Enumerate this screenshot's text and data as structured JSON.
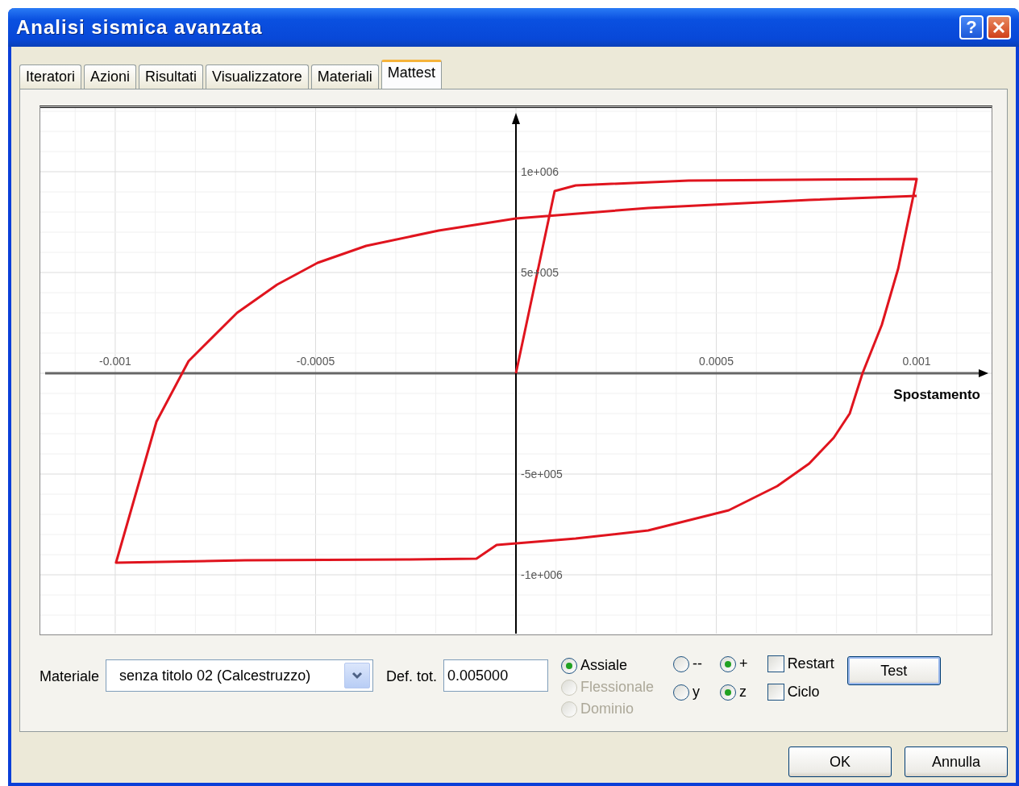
{
  "window": {
    "title": "Analisi sismica avanzata",
    "help_button": "?"
  },
  "tabs": [
    {
      "label": "Iteratori",
      "selected": false
    },
    {
      "label": "Azioni",
      "selected": false
    },
    {
      "label": "Risultati",
      "selected": false
    },
    {
      "label": "Visualizzatore",
      "selected": false
    },
    {
      "label": "Materiali",
      "selected": false
    },
    {
      "label": "Mattest",
      "selected": true
    }
  ],
  "chart": {
    "chart_data": {
      "type": "line",
      "grid": true,
      "xlabel": "Spostamento",
      "xlim": [
        -0.001187,
        0.001187
      ],
      "ylim": [
        -1292000,
        1316000
      ],
      "xticks": [
        {
          "value": -0.001,
          "label": "-0.001"
        },
        {
          "value": -0.0005,
          "label": "-0.0005"
        },
        {
          "value": 0.0005,
          "label": "0.0005"
        },
        {
          "value": 0.001,
          "label": "0.001"
        }
      ],
      "yticks": [
        {
          "value": 1000000,
          "label": "1e+006"
        },
        {
          "value": 500000,
          "label": "5e+005"
        },
        {
          "value": -500000,
          "label": "-5e+005"
        },
        {
          "value": -1000000,
          "label": "-1e+006"
        }
      ],
      "x": [
        0,
        9.66e-05,
        0.000149,
        0.000431,
        0.001,
        0.00099,
        0.000954,
        0.000913,
        0.000865,
        0.000833,
        0.000793,
        0.000732,
        0.000652,
        0.000531,
        0.00033,
        0.000149,
        -4.83e-05,
        -9.86e-05,
        -0.000274,
        -0.000676,
        -0.000998,
        -0.000897,
        -0.000817,
        -0.000696,
        -0.000596,
        -0.000495,
        -0.000374,
        -0.000193,
        0,
        0.00033,
        0.000732,
        0.001
      ],
      "series": [
        {
          "color": "#e0141e",
          "values": [
            0,
            904000,
            932000,
            956000,
            964000,
            864000,
            520000,
            240000,
            0,
            -200000,
            -320000,
            -448000,
            -560000,
            -680000,
            -780000,
            -820000,
            -852000,
            -920000,
            -924000,
            -928000,
            -940000,
            -240000,
            60000,
            300000,
            440000,
            548000,
            632000,
            708000,
            768000,
            820000,
            860000,
            880000
          ]
        }
      ]
    }
  },
  "controls": {
    "material_label": "Materiale",
    "material_value": "senza titolo 02 (Calcestruzzo)",
    "def_label": "Def. tot.",
    "def_value": "0.005000",
    "modes": [
      {
        "label": "Assiale",
        "selected": true,
        "disabled": false
      },
      {
        "label": "Flessionale",
        "selected": false,
        "disabled": true
      },
      {
        "label": "Dominio",
        "selected": false,
        "disabled": true
      }
    ],
    "signs": [
      {
        "label": "--",
        "selected": false
      },
      {
        "label": "+",
        "selected": true
      }
    ],
    "axes": [
      {
        "label": "y",
        "selected": false
      },
      {
        "label": "z",
        "selected": true
      }
    ],
    "checkboxes": [
      {
        "label": "Restart",
        "checked": false
      },
      {
        "label": "Ciclo",
        "checked": false
      }
    ],
    "test_button": "Test"
  },
  "buttons": [
    "OK",
    "Annulla"
  ]
}
